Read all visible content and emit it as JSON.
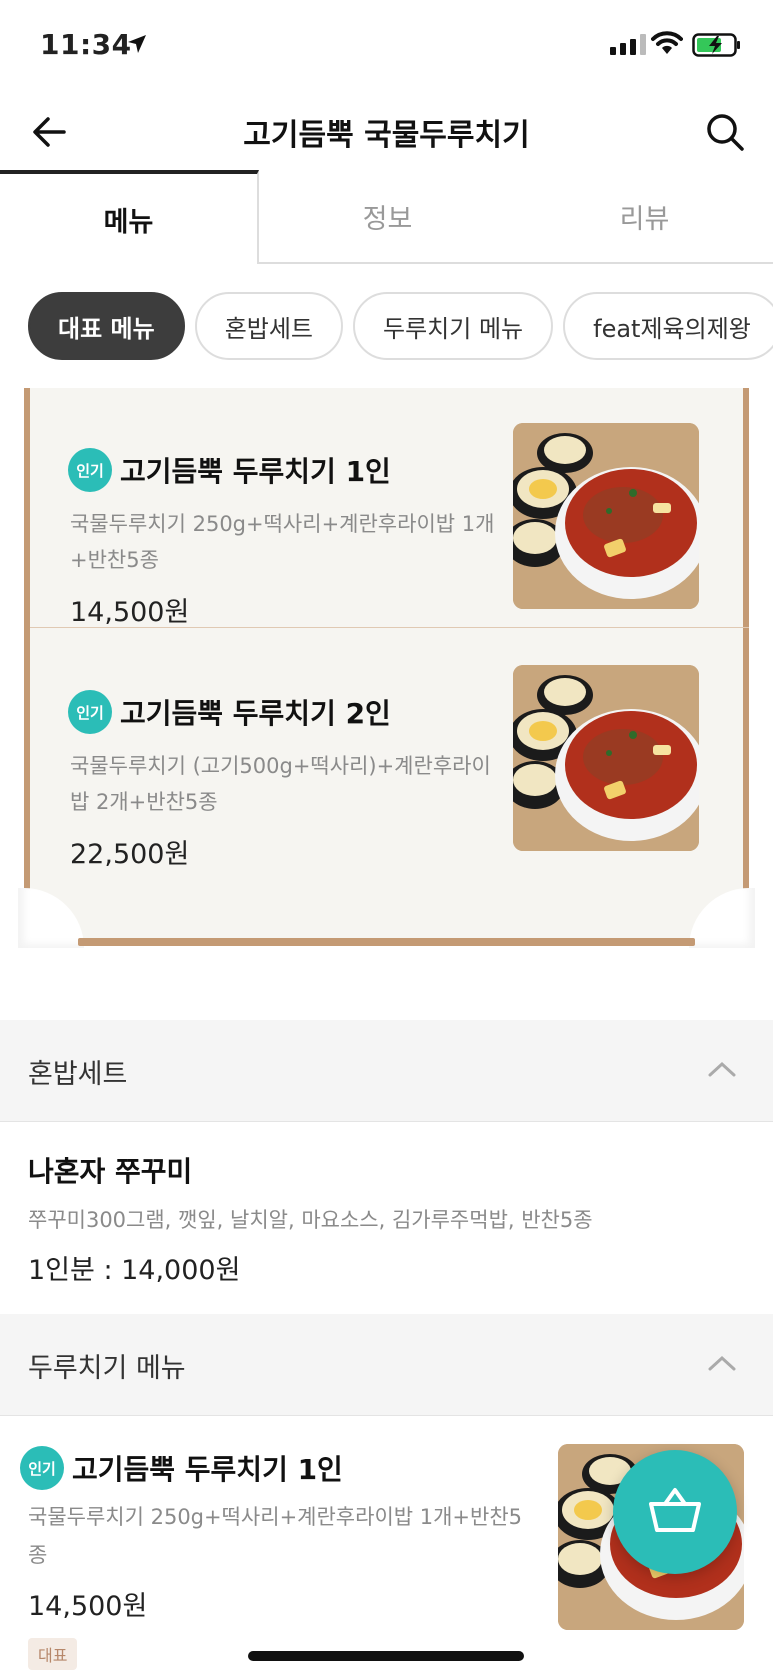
{
  "status_bar": {
    "time": "11:34"
  },
  "nav": {
    "title": "고기듬뿍 국물두루치기"
  },
  "tabs": [
    {
      "label": "메뉴",
      "active": true
    },
    {
      "label": "정보",
      "active": false
    },
    {
      "label": "리뷰",
      "active": false
    }
  ],
  "chips": [
    {
      "label": "대표 메뉴",
      "active": true
    },
    {
      "label": "혼밥세트",
      "active": false
    },
    {
      "label": "두루치기 메뉴",
      "active": false
    },
    {
      "label": "feat제육의제왕",
      "active": false
    }
  ],
  "featured": {
    "items": [
      {
        "badge": "인기",
        "name": "고기듬뿍 두루치기 1인",
        "desc": "국물두루치기 250g+떡사리+계란후라이밥 1개+반찬5종",
        "price": "14,500원"
      },
      {
        "badge": "인기",
        "name": "고기듬뿍 두루치기 2인",
        "desc": "국물두루치기 (고기500g+떡사리)+계란후라이밥 2개+반찬5종",
        "price": "22,500원"
      }
    ]
  },
  "sections": [
    {
      "label": "혼밥세트",
      "items": [
        {
          "name": "나혼자 쭈꾸미",
          "desc": "쭈꾸미300그램, 깻잎, 날치알, 마요소스, 김가루주먹밥, 반찬5종",
          "price": "1인분 : 14,000원"
        }
      ]
    },
    {
      "label": "두루치기 메뉴",
      "items": [
        {
          "badge": "인기",
          "name": "고기듬뿍 두루치기 1인",
          "desc": "국물두루치기 250g+떡사리+계란후라이밥 1개+반찬5종",
          "price": "14,500원",
          "tag": "대표"
        }
      ]
    }
  ],
  "colors": {
    "accent": "#2bbdb7",
    "paper_border": "#c49a74",
    "active_chip": "#3d3d3d"
  },
  "icons": {
    "back": "arrow-left-icon",
    "search": "search-icon",
    "collapse": "chevron-up-icon",
    "cart": "basket-icon"
  }
}
